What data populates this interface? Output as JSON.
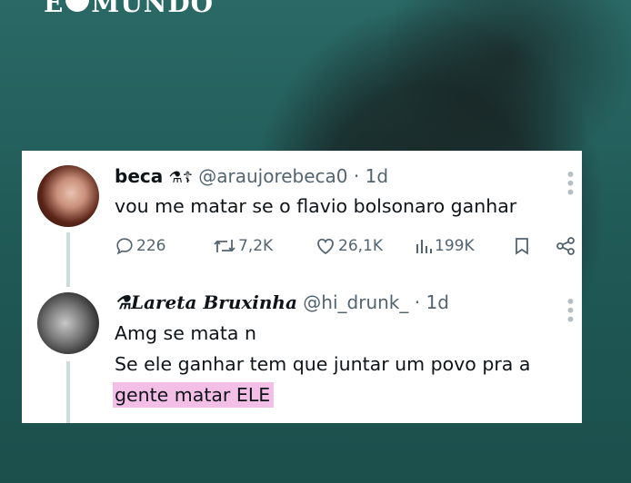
{
  "brand": {
    "text_left": "E",
    "text_right": "MUNDO"
  },
  "tweet1": {
    "display_name": "beca",
    "emoji": "⚗☦",
    "handle": "@araujorebeca0",
    "time": "· 1d",
    "text": "vou me matar se o flavio bolsonaro ganhar",
    "replies": "226",
    "retweets": "7,2K",
    "likes": "26,1K",
    "views": "199K"
  },
  "tweet2": {
    "display_name": "Lareta Bruxinha",
    "display_prefix": "⚗",
    "handle": "@hi_drunk_",
    "time": "· 1d",
    "line1": "Amg se mata n",
    "line2": "Se ele ganhar tem que juntar um povo pra a",
    "line3": "gente matar ELE"
  },
  "colors": {
    "highlight": "#f3bfe6",
    "muted": "#536471",
    "text": "#0f1419"
  }
}
